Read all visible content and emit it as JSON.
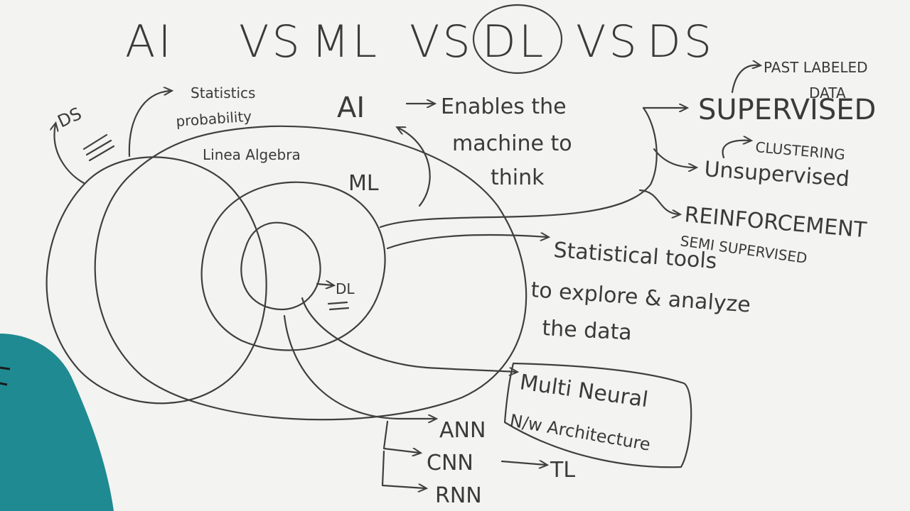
{
  "title": {
    "ai": "AI",
    "vs1": "VS",
    "ml": "ML",
    "vs2": "VS",
    "dl": "DL",
    "vs3": "VS",
    "ds": "DS"
  },
  "circles": {
    "ds": "DS",
    "stats": "Statistics",
    "probability": "probability",
    "linear_algebra": "Linea Algebra",
    "ml": "ML",
    "dl": "DL"
  },
  "ai_definition": {
    "ai": "AI",
    "enables": "Enables the",
    "machine": "machine to",
    "think": "think"
  },
  "ml_types": {
    "supervised": "SUPERVISED",
    "past_labeled": "PAST LABELED",
    "data": "DATA",
    "unsupervised": "Unsupervised",
    "clustering": "CLUSTERING",
    "reinforcement": "REINFORCEMENT",
    "semi_supervised": "SEMI SUPERVISED"
  },
  "ds_definition": {
    "line1": "Statistical tools",
    "line2": "to explore & analyze",
    "line3": "the data"
  },
  "dl_box": {
    "line1": "Multi Neural",
    "line2": "N/w Architecture"
  },
  "dl_types": {
    "ann": "ANN",
    "cnn": "CNN",
    "rnn": "RNN",
    "tl": "TL"
  },
  "person": {
    "shirt_color": "#1f8a92"
  }
}
